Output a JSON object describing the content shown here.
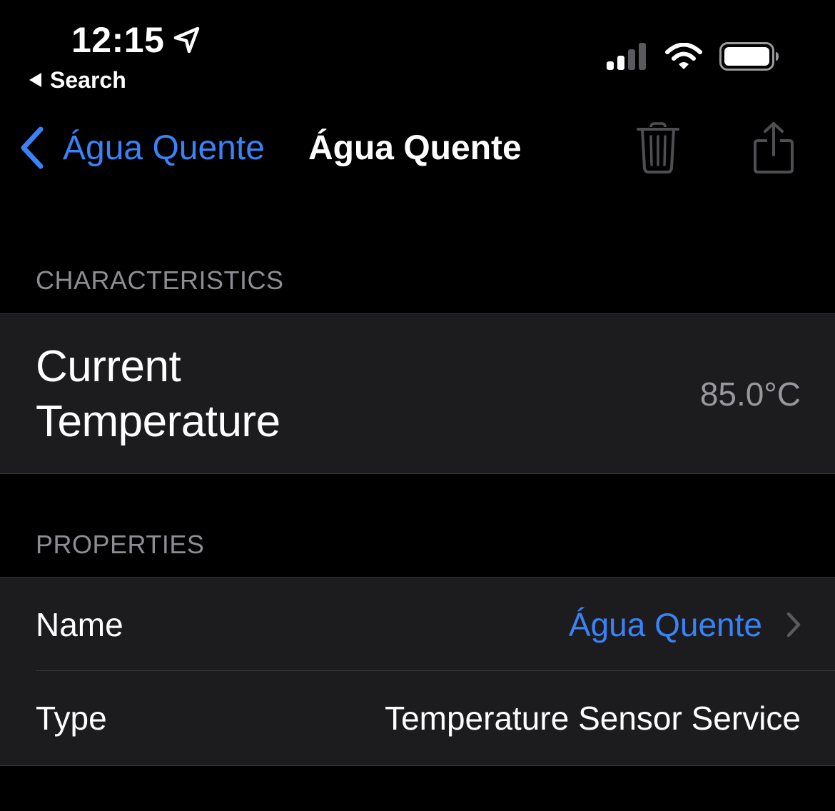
{
  "status_bar": {
    "time": "12:15",
    "location_icon": "location-arrow-icon",
    "back_app_label": "Search",
    "signal_icon": "cellular-signal-icon",
    "wifi_icon": "wifi-icon",
    "battery_icon": "battery-icon"
  },
  "nav": {
    "back_label": "Água Quente",
    "title": "Água Quente",
    "trash_icon": "trash-icon",
    "share_icon": "share-icon"
  },
  "characteristics": {
    "header": "CHARACTERISTICS",
    "current_temperature": {
      "label_line1": "Current",
      "label_line2": "Temperature",
      "value": "85.0°C"
    }
  },
  "properties": {
    "header": "PROPERTIES",
    "rows": [
      {
        "label": "Name",
        "value": "Água Quente",
        "disclosure_icon": "chevron-right-icon"
      },
      {
        "label": "Type",
        "value": "Temperature Sensor Service"
      }
    ]
  },
  "colors": {
    "background": "#000000",
    "cell_background": "#1c1c1e",
    "accent_blue": "#3a82f7",
    "secondary_text": "#8d8d93",
    "separator": "#38383a"
  }
}
